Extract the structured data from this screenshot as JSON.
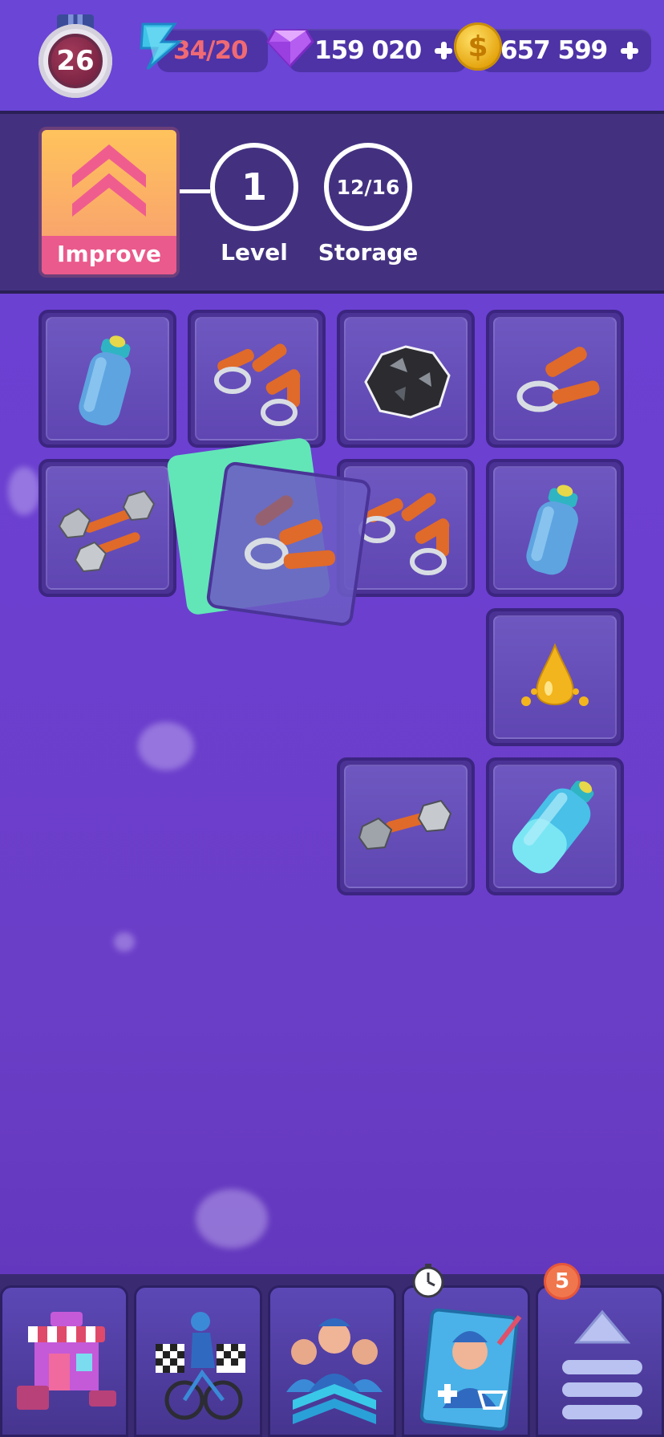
{
  "top_bar": {
    "player_level": "26",
    "energy": "34/20",
    "gems": "159 020",
    "coins": "657 599"
  },
  "building": {
    "improve_label": "Improve",
    "level_value": "1",
    "level_label": "Level",
    "storage_value": "12/16",
    "storage_label": "Storage"
  },
  "grid_items": [
    {
      "name": "water-bottle-small-icon"
    },
    {
      "name": "hand-grippers-pair-icon"
    },
    {
      "name": "coal-rock-icon"
    },
    {
      "name": "hand-gripper-icon"
    },
    {
      "name": "dumbbells-pair-icon"
    },
    {
      "name": "hand-gripper-dragged-icon"
    },
    {
      "name": "hand-grippers-pair-icon"
    },
    {
      "name": "water-bottle-small-icon"
    },
    {
      "name": "oil-drop-icon"
    },
    {
      "name": "dumbbell-icon"
    },
    {
      "name": "water-bottle-large-icon"
    }
  ],
  "bottom_nav": {
    "notification_count": "5",
    "items": [
      {
        "name": "shop-icon"
      },
      {
        "name": "race-cyclist-icon"
      },
      {
        "name": "team-upgrade-icon"
      },
      {
        "name": "recruit-rider-icon"
      },
      {
        "name": "menu-icon"
      }
    ]
  },
  "colors": {
    "background": "#6b42d0",
    "panel": "#433180",
    "improve_pink": "#ea5a8c",
    "energy_text": "#f06a74",
    "drag_highlight": "#62e6b7"
  }
}
